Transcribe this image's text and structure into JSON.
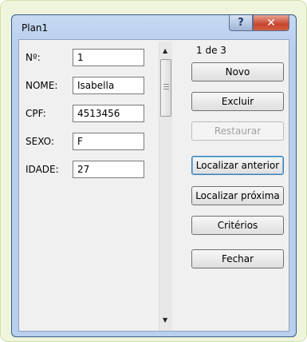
{
  "window": {
    "title": "Plan1"
  },
  "fields": [
    {
      "label": "Nº:",
      "value": "1"
    },
    {
      "label": "NOME:",
      "value": "Isabella"
    },
    {
      "label": "CPF:",
      "value": "4513456"
    },
    {
      "label": "SEXO:",
      "value": "F"
    },
    {
      "label": "IDADE:",
      "value": "27"
    }
  ],
  "record_counter": "1 de 3",
  "buttons": {
    "novo": "Novo",
    "excluir": "Excluir",
    "restaurar": "Restaurar",
    "localizar_anterior": "Localizar anterior",
    "localizar_proxima": "Localizar próxima",
    "criterios": "Critérios",
    "fechar": "Fechar"
  },
  "icons": {
    "help": "question-mark",
    "close": "x-mark"
  }
}
